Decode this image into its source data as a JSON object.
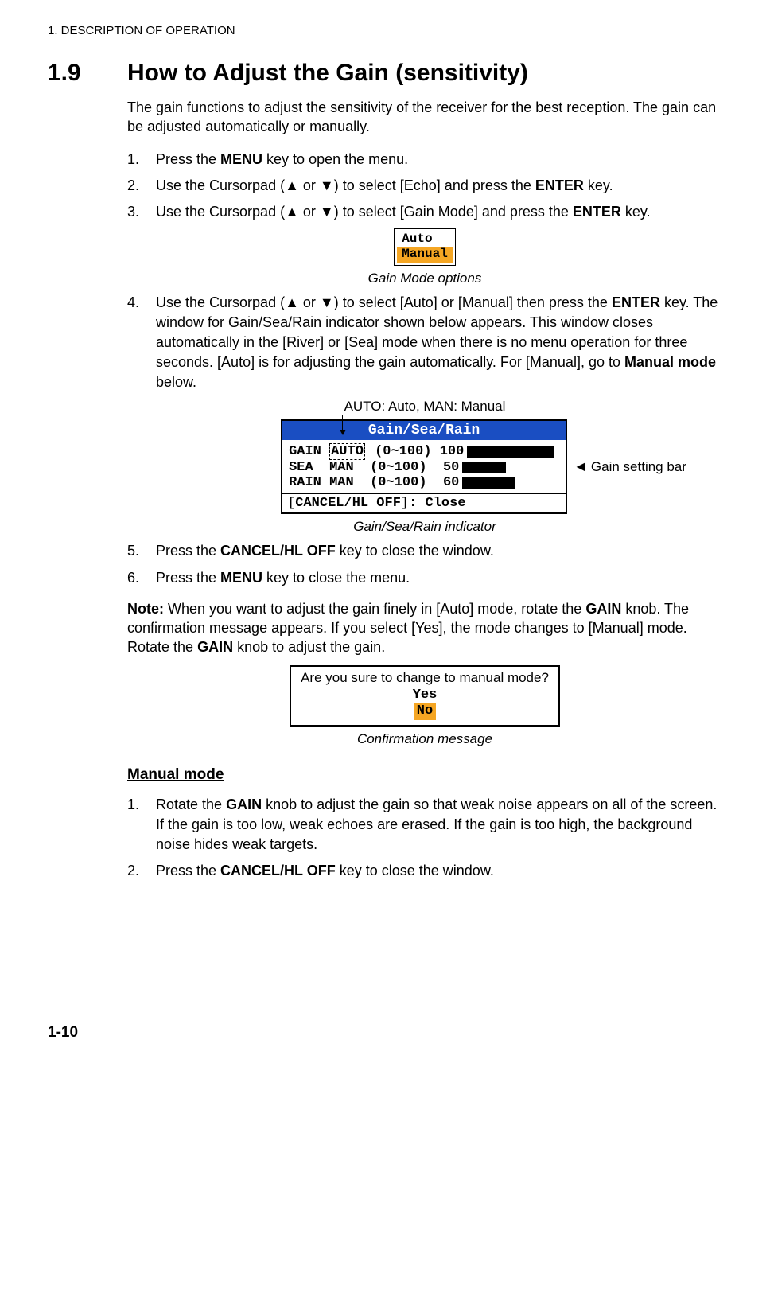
{
  "chapter_header": "1.  DESCRIPTION OF OPERATION",
  "section": {
    "number": "1.9",
    "title": "How to Adjust the Gain (sensitivity)",
    "intro": "The gain functions to adjust the sensitivity of the receiver for the best reception. The gain can be adjusted automatically or manually."
  },
  "steps1": {
    "n1": "1.",
    "t1a": "Press the ",
    "t1b": "MENU",
    "t1c": " key to open the menu.",
    "n2": "2.",
    "t2a": "Use the Cursorpad (",
    "t2b": "▲",
    "t2c": " or ",
    "t2d": "▼",
    "t2e": ") to select [Echo] and press the ",
    "t2f": "ENTER",
    "t2g": " key.",
    "n3": "3.",
    "t3a": "Use the Cursorpad (",
    "t3b": "▲",
    "t3c": " or ",
    "t3d": "▼",
    "t3e": ") to select [Gain Mode] and press the ",
    "t3f": "ENTER",
    "t3g": " key."
  },
  "fig1": {
    "auto": "Auto",
    "manual": "Manual",
    "caption": "Gain Mode options"
  },
  "steps1b": {
    "n4": "4.",
    "t4a": "Use the Cursorpad (",
    "t4b": "▲",
    "t4c": " or ",
    "t4d": "▼",
    "t4e": ") to select [Auto] or [Manual] then press the ",
    "t4f": "ENTER",
    "t4g": " key. The window for Gain/Sea/Rain indicator shown below appears. This window closes automatically in the [River] or [Sea] mode when there is no menu operation for three seconds. [Auto] is for adjusting the gain automatically. For [Manual], go to ",
    "t4h": "Manual mode",
    "t4i": " below."
  },
  "fig2": {
    "top_callout": "AUTO: Auto, MAN: Manual",
    "titlebar": "Gain/Sea/Rain",
    "r1_label": "GAIN ",
    "r1_auto": "AUTO",
    "r1_range": " (0~100) ",
    "r1_val": "100",
    "r2_label": "SEA  MAN ",
    "r2_range": " (0~100)  ",
    "r2_val": "50",
    "r3_label": "RAIN MAN ",
    "r3_range": " (0~100)  ",
    "r3_val": "60",
    "close": "[CANCEL/HL OFF]: Close",
    "side_callout": "Gain setting bar",
    "caption": "Gain/Sea/Rain indicator"
  },
  "steps1c": {
    "n5": "5.",
    "t5a": "Press the ",
    "t5b": "CANCEL/HL OFF",
    "t5c": " key to close the window.",
    "n6": "6.",
    "t6a": "Press the ",
    "t6b": "MENU",
    "t6c": " key to close the menu."
  },
  "note": {
    "lead": "Note:",
    "a": " When you want to adjust the gain finely in [Auto] mode, rotate the ",
    "b": "GAIN",
    "c": " knob. The confirmation message appears. If you select [Yes], the mode changes to [Manual] mode. Rotate the ",
    "d": "GAIN",
    "e": " knob to adjust the gain."
  },
  "fig3": {
    "question": "Are you sure to change to manual mode?",
    "yes": "Yes",
    "no": "No",
    "caption": "Confirmation message"
  },
  "manual_mode": {
    "heading": "Manual mode",
    "n1": "1.",
    "t1a": "Rotate the ",
    "t1b": "GAIN",
    "t1c": " knob to adjust the gain so that weak noise appears on all of the screen. If the gain is too low, weak echoes are erased. If the gain is too high, the background noise hides weak targets.",
    "n2": "2.",
    "t2a": "Press the ",
    "t2b": "CANCEL/HL OFF",
    "t2c": " key to close the window."
  },
  "page_number": "1-10",
  "chart_data": {
    "type": "bar",
    "title": "Gain/Sea/Rain",
    "categories": [
      "GAIN",
      "SEA",
      "RAIN"
    ],
    "modes": [
      "AUTO",
      "MAN",
      "MAN"
    ],
    "range": "0~100",
    "values": [
      100,
      50,
      60
    ],
    "xlabel": "",
    "ylabel": "",
    "ylim": [
      0,
      100
    ]
  }
}
